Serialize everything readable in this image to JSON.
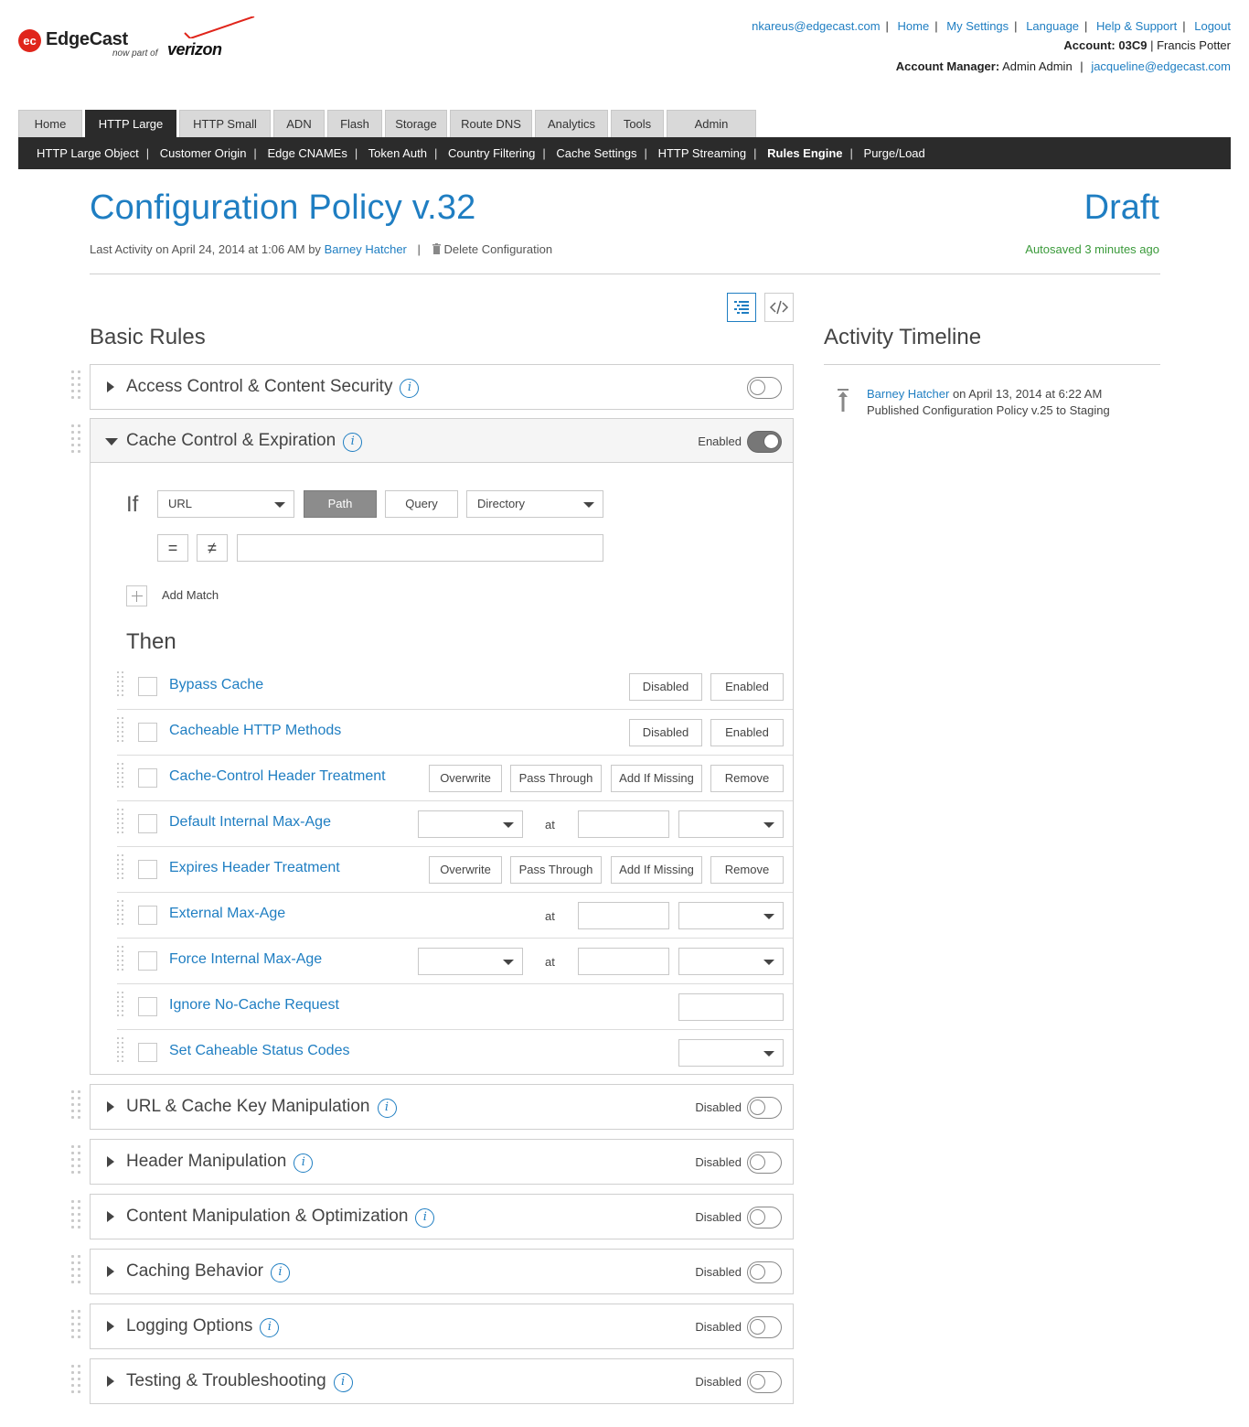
{
  "brand": {
    "logo_mark": "ec",
    "name": "EdgeCast",
    "tagline": "now part of",
    "parent": "verizon",
    "accent_color": "#e0251b"
  },
  "top_links": [
    "nkareus@edgecast.com",
    "Home",
    "My Settings",
    "Language",
    "Help & Support",
    "Logout"
  ],
  "account": {
    "label": "Account:",
    "code": "03C9",
    "owner": "Francis Potter",
    "manager_label": "Account Manager:",
    "manager_name": "Admin Admin",
    "manager_email": "jacqueline@edgecast.com"
  },
  "main_tabs": [
    "Home",
    "HTTP Large",
    "HTTP Small",
    "ADN",
    "Flash",
    "Storage",
    "Route DNS",
    "Analytics",
    "Tools",
    "Admin"
  ],
  "main_tabs_active": "HTTP Large",
  "sub_nav": [
    "HTTP Large Object",
    "Customer Origin",
    "Edge CNAMEs",
    "Token Auth",
    "Country Filtering",
    "Cache Settings",
    "HTTP Streaming",
    "Rules Engine",
    "Purge/Load"
  ],
  "sub_nav_active": "Rules Engine",
  "header": {
    "title": "Configuration Policy v.32",
    "status": "Draft",
    "last_activity_prefix": "Last Activity on April 24, 2014 at 1:06 AM by",
    "last_activity_user": "Barney Hatcher",
    "delete_label": "Delete Configuration",
    "autosaved": "Autosaved 3 minutes ago"
  },
  "view_toggle": {
    "list_icon": "list-view-icon",
    "code_icon": "code-view-icon"
  },
  "basic_rules_title": "Basic Rules",
  "timeline": {
    "title": "Activity Timeline",
    "items": [
      {
        "user": "Barney Hatcher",
        "when": " on April 13, 2014 at 6:22 AM",
        "action": "Published Configuration Policy v.25 to Staging",
        "icon": "publish-arrow-icon"
      }
    ]
  },
  "sections": [
    {
      "title": "Access Control & Content Security",
      "state": "",
      "enabled": false
    },
    {
      "title": "Cache Control & Expiration",
      "state": "Enabled",
      "enabled": true,
      "expanded": true
    },
    {
      "title": "URL & Cache Key Manipulation",
      "state": "Disabled",
      "enabled": false
    },
    {
      "title": "Header Manipulation",
      "state": "Disabled",
      "enabled": false
    },
    {
      "title": "Content Manipulation & Optimization",
      "state": "Disabled",
      "enabled": false
    },
    {
      "title": "Caching Behavior",
      "state": "Disabled",
      "enabled": false
    },
    {
      "title": "Logging Options",
      "state": "Disabled",
      "enabled": false
    },
    {
      "title": "Testing & Troubleshooting",
      "state": "Disabled",
      "enabled": false
    }
  ],
  "condition": {
    "if_label": "If",
    "match_type": "URL",
    "parts": [
      "Path",
      "Query"
    ],
    "active_part": "Path",
    "scope": "Directory",
    "equals": "=",
    "not_equals": "≠",
    "value": "",
    "add_match": "Add Match"
  },
  "then_label": "Then",
  "features": [
    {
      "name": "Bypass Cache",
      "buttons": [
        "Disabled",
        "Enabled"
      ]
    },
    {
      "name": "Cacheable HTTP Methods",
      "buttons": [
        "Disabled",
        "Enabled"
      ]
    },
    {
      "name": "Cache-Control Header Treatment",
      "buttons": [
        "Overwrite",
        "Pass Through",
        "Add If Missing",
        "Remove"
      ]
    },
    {
      "name": "Default Internal Max-Age",
      "at": "at"
    },
    {
      "name": "Expires Header Treatment",
      "buttons": [
        "Overwrite",
        "Pass Through",
        "Add If Missing",
        "Remove"
      ]
    },
    {
      "name": "External Max-Age",
      "at": "at"
    },
    {
      "name": "Force Internal Max-Age",
      "at": "at"
    },
    {
      "name": "Ignore No-Cache Request"
    },
    {
      "name": "Set Caheable Status Codes"
    }
  ]
}
